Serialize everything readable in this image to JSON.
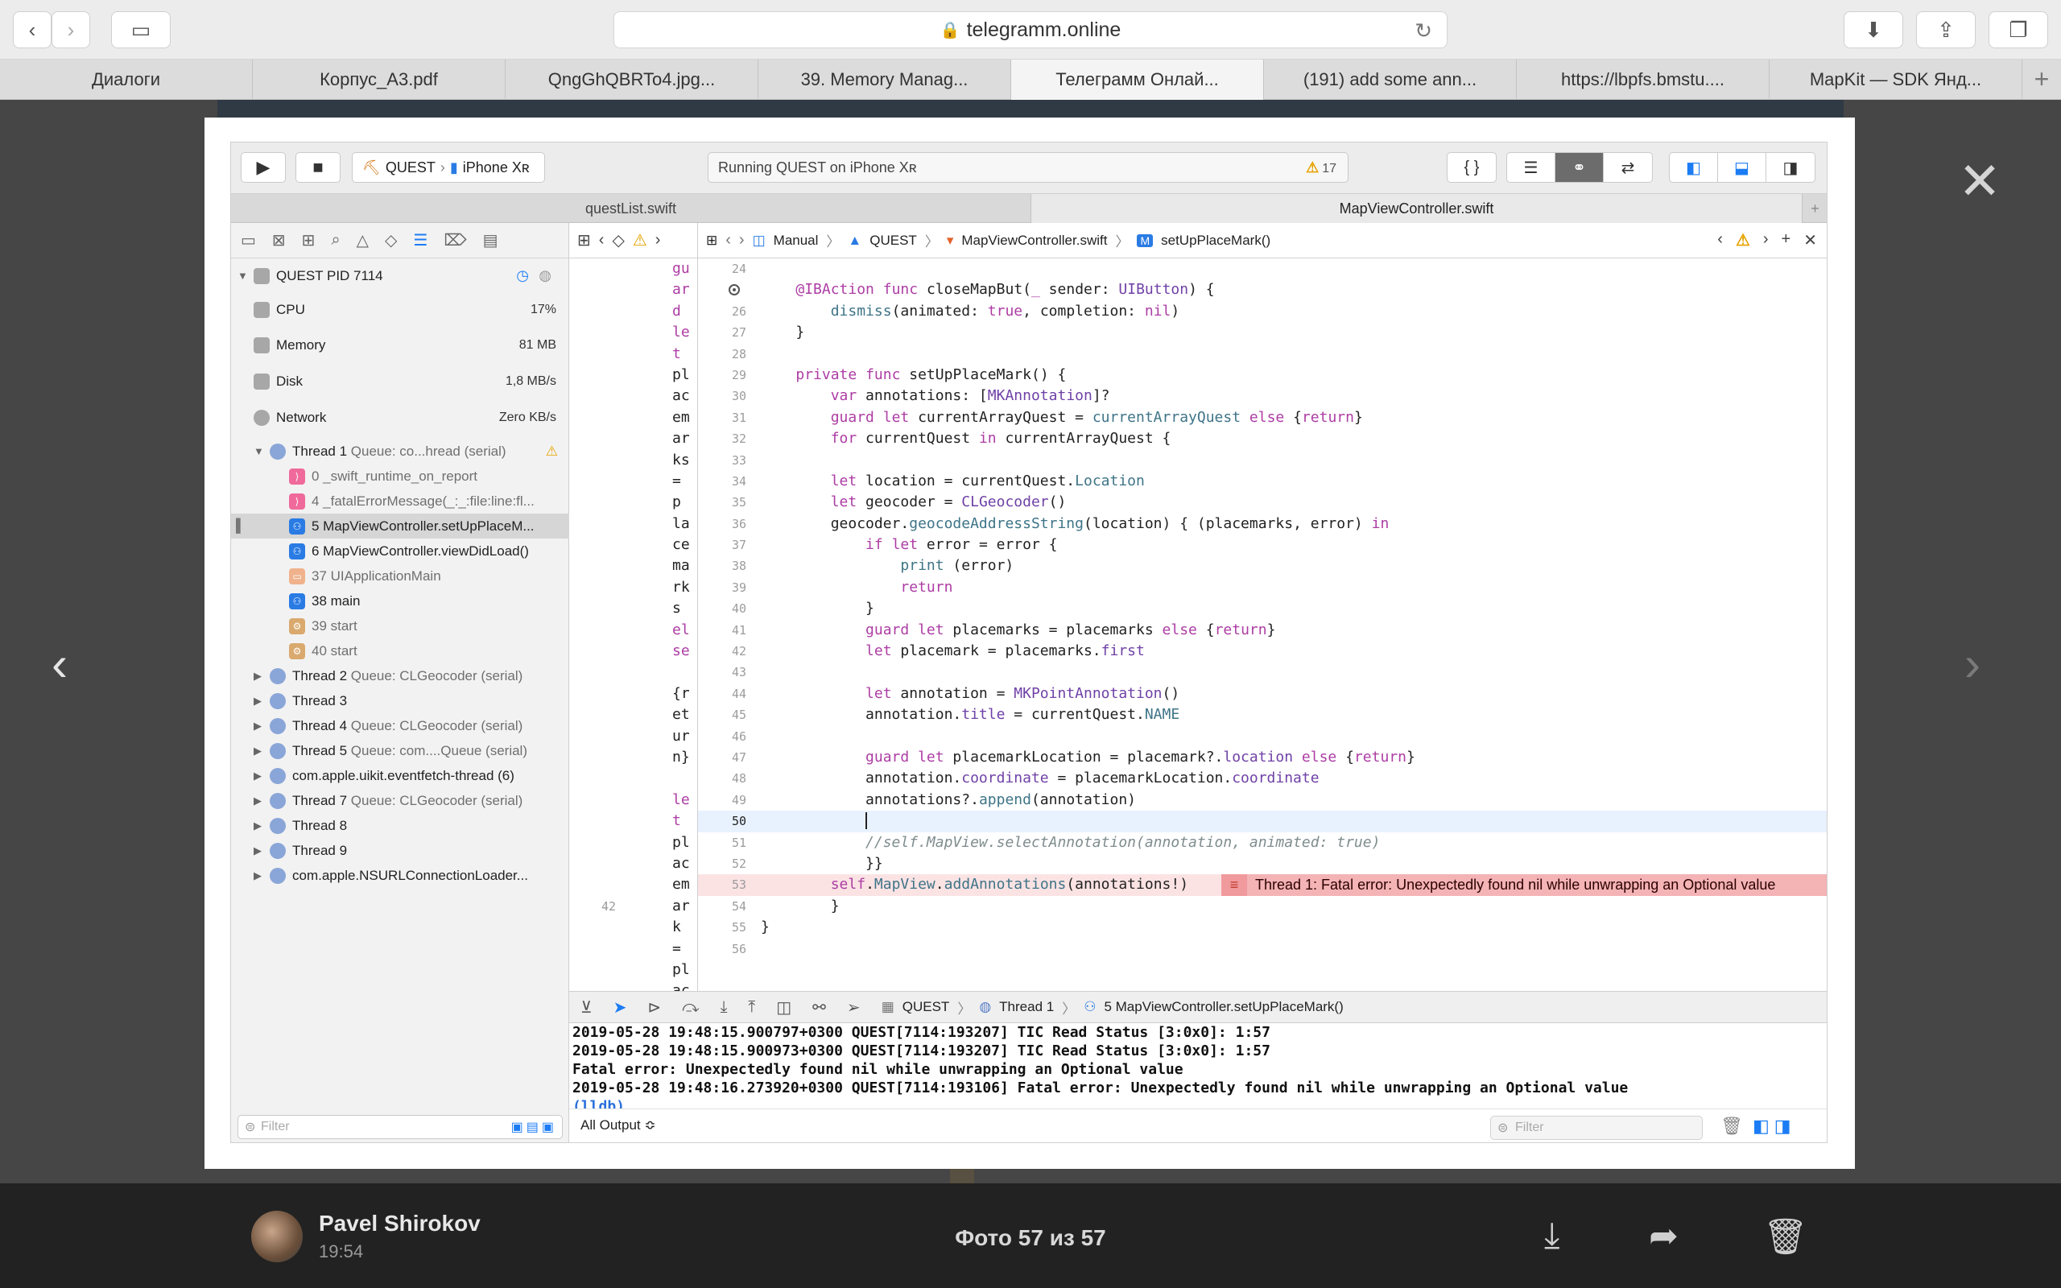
{
  "browser": {
    "url": "telegramm.online",
    "tabs": [
      "Диалоги",
      "Корпус_А3.pdf",
      "QngGhQBRTo4.jpg...",
      "39. Memory Manag...",
      "Телеграмм Онлай...",
      "(191) add some ann...",
      "https://lbpfs.bmstu....",
      "MapKit — SDK Янд..."
    ],
    "active_tab": 4
  },
  "xcode": {
    "scheme": "QUEST",
    "device": "iPhone Xʀ",
    "status": "Running QUEST on iPhone Xʀ",
    "warning_count": "17",
    "editor_tabs": [
      "questList.swift",
      "MapViewController.swift"
    ],
    "jump_bar": [
      "Manual",
      "QUEST",
      "MapViewController.swift",
      "setUpPlaceMark()"
    ],
    "navigator": {
      "process": "QUEST PID 7114",
      "gauges": [
        {
          "name": "CPU",
          "value": "17%"
        },
        {
          "name": "Memory",
          "value": "81 MB"
        },
        {
          "name": "Disk",
          "value": "1,8 MB/s"
        },
        {
          "name": "Network",
          "value": "Zero KB/s"
        }
      ],
      "thread1": "Thread 1",
      "thread1_queue": "Queue: co...hread (serial)",
      "frames": [
        "0 _swift_runtime_on_report",
        "4 _fatalErrorMessage(_:_:file:line:fl...",
        "5 MapViewController.setUpPlaceM...",
        "6 MapViewController.viewDidLoad()",
        "37 UIApplicationMain",
        "38 main",
        "39 start",
        "40 start"
      ],
      "threads": [
        {
          "name": "Thread 2",
          "queue": "Queue: CLGeocoder (serial)"
        },
        {
          "name": "Thread 3",
          "queue": ""
        },
        {
          "name": "Thread 4",
          "queue": "Queue: CLGeocoder (serial)"
        },
        {
          "name": "Thread 5",
          "queue": "Queue: com....Queue (serial)"
        },
        {
          "name": "com.apple.uikit.eventfetch-thread (6)",
          "queue": ""
        },
        {
          "name": "Thread 7",
          "queue": "Queue: CLGeocoder (serial)"
        },
        {
          "name": "Thread 8",
          "queue": ""
        },
        {
          "name": "Thread 9",
          "queue": ""
        },
        {
          "name": "com.apple.NSURLConnectionLoader...",
          "queue": ""
        }
      ],
      "filter_placeholder": "Filter"
    },
    "assistant_gutter_number": "42",
    "assistant_lines": [
      "gu",
      "ar",
      "d",
      "le",
      "t",
      "pl",
      "ac",
      "em",
      "ar",
      "ks",
      " =",
      "p",
      "la",
      "ce",
      "ma",
      "rk",
      "s",
      "el",
      "se",
      "",
      "{r",
      "et",
      "ur",
      "n}",
      "",
      "le",
      "t",
      "pl",
      "ac",
      "em",
      "ar",
      "k",
      "=",
      "pl",
      "ac"
    ],
    "error_message": "Thread 1: Fatal error: Unexpectedly found nil while unwrapping an Optional value",
    "debug_path": [
      "QUEST",
      "Thread 1",
      "5 MapViewController.setUpPlaceMark()"
    ],
    "console_lines": [
      "2019-05-28 19:48:15.900797+0300 QUEST[7114:193207] TIC Read Status [3:0x0]: 1:57",
      "2019-05-28 19:48:15.900973+0300 QUEST[7114:193207] TIC Read Status [3:0x0]: 1:57",
      "Fatal error: Unexpectedly found nil while unwrapping an Optional value",
      "2019-05-28 19:48:16.273920+0300 QUEST[7114:193106] Fatal error: Unexpectedly found nil while unwrapping an Optional value"
    ],
    "lldb_prompt": "(lldb)",
    "output_select": "All Output ≎",
    "console_filter_placeholder": "Filter"
  },
  "viewer": {
    "sender": "Pavel Shirokov",
    "time": "19:54",
    "counter": "Фото 57 из 57"
  }
}
